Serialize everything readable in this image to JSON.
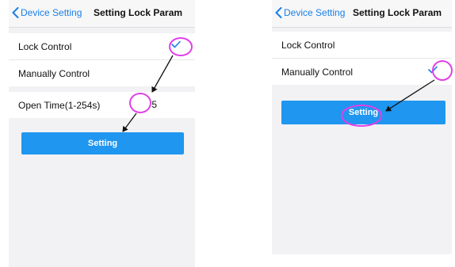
{
  "accent": "#1a7fe6",
  "annotation_color": "#e040e8",
  "left_screen": {
    "back_label": "Device Setting",
    "title": "Setting Lock Param",
    "options": [
      {
        "label": "Lock Control",
        "checked": true
      },
      {
        "label": "Manually Control",
        "checked": false
      }
    ],
    "open_time_label": "Open Time(1-254s)",
    "open_time_value": "5",
    "setting_button": "Setting"
  },
  "right_screen": {
    "back_label": "Device Setting",
    "title": "Setting Lock Param",
    "options": [
      {
        "label": "Lock Control",
        "checked": false
      },
      {
        "label": "Manually Control",
        "checked": true
      }
    ],
    "setting_button": "Setting"
  }
}
